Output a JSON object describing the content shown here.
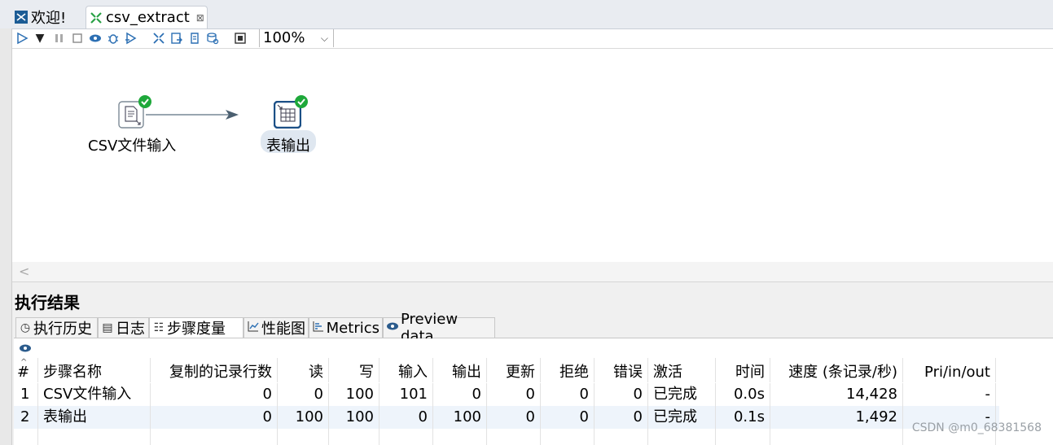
{
  "tabs": [
    {
      "label": "欢迎!"
    },
    {
      "label": "csv_extract",
      "close": "⊠"
    }
  ],
  "toolbar": {
    "zoom": "100%"
  },
  "canvas": {
    "steps": [
      {
        "label": "CSV文件输入"
      },
      {
        "label": "表输出"
      }
    ]
  },
  "results": {
    "title": "执行结果",
    "tabs": [
      "执行历史",
      "日志",
      "步骤度量",
      "性能图",
      "Metrics",
      "Preview data"
    ],
    "columns": [
      "#",
      "步骤名称",
      "复制的记录行数",
      "读",
      "写",
      "输入",
      "输出",
      "更新",
      "拒绝",
      "错误",
      "激活",
      "时间",
      "速度 (条记录/秒)",
      "Pri/in/out"
    ],
    "rows": [
      [
        "1",
        "CSV文件输入",
        "0",
        "0",
        "100",
        "101",
        "0",
        "0",
        "0",
        "0",
        "已完成",
        "0.0s",
        "14,428",
        "-"
      ],
      [
        "2",
        "表输出",
        "0",
        "100",
        "100",
        "0",
        "100",
        "0",
        "0",
        "0",
        "已完成",
        "0.1s",
        "1,492",
        "-"
      ]
    ]
  },
  "watermark": "CSDN @m0_68381568",
  "colors": {
    "accent": "#2c6fb3",
    "success": "#1ea83a"
  }
}
